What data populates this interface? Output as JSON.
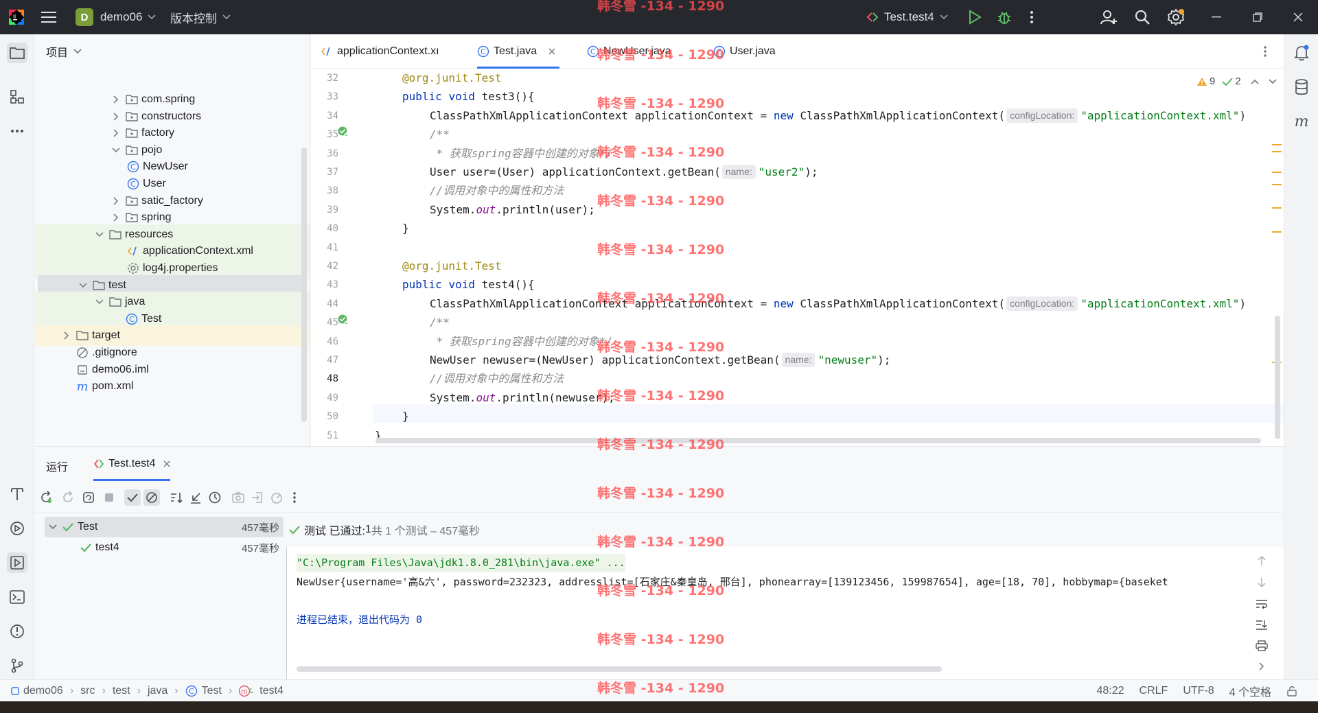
{
  "titlebar": {
    "project_badge": "D",
    "project_name": "demo06",
    "vcs_menu": "版本控制",
    "run_config": "Test.test4"
  },
  "project_panel": {
    "title": "项目",
    "tree": [
      {
        "label": "com.spring",
        "type": "package"
      },
      {
        "label": "constructors",
        "type": "package"
      },
      {
        "label": "factory",
        "type": "package"
      },
      {
        "label": "pojo",
        "type": "package"
      },
      {
        "label": "NewUser",
        "type": "class"
      },
      {
        "label": "User",
        "type": "class"
      },
      {
        "label": "satic_factory",
        "type": "package"
      },
      {
        "label": "spring",
        "type": "package"
      },
      {
        "label": "resources",
        "type": "folder"
      },
      {
        "label": "applicationContext.xml",
        "type": "xml"
      },
      {
        "label": "log4j.properties",
        "type": "properties"
      },
      {
        "label": "test",
        "type": "folder"
      },
      {
        "label": "java",
        "type": "folder"
      },
      {
        "label": "Test",
        "type": "class"
      },
      {
        "label": "target",
        "type": "folder"
      },
      {
        "label": ".gitignore",
        "type": "ignore"
      },
      {
        "label": "demo06.iml",
        "type": "iml"
      },
      {
        "label": "pom.xml",
        "type": "maven"
      }
    ]
  },
  "editor": {
    "tabs": [
      {
        "label": "applicationContext.xı",
        "icon": "xml-icon"
      },
      {
        "label": "Test.java",
        "icon": "class-icon",
        "active": true
      },
      {
        "label": "NewUser.java",
        "icon": "class-icon"
      },
      {
        "label": "User.java",
        "icon": "class-icon"
      }
    ],
    "inspections": {
      "warnings": "9",
      "ok": "2"
    },
    "line_numbers": [
      "32",
      "33",
      "34",
      "35",
      "36",
      "37",
      "38",
      "39",
      "40",
      "41",
      "42",
      "43",
      "44",
      "45",
      "46",
      "47",
      "48",
      "49",
      "50",
      "51"
    ],
    "code": {
      "l32_annotation": "@org.junit.",
      "l32_test": "Test",
      "l33_public": "public ",
      "l33_void": "void ",
      "l33_sig": "test3(){",
      "l34_a": "ClassPathXmlApplicationContext applicationContext = ",
      "l34_new": "new ",
      "l34_b": "ClassPathXmlApplicationContext(",
      "l34_hint": "configLocation:",
      "l34_str": "\"applicationContext.xml\"",
      "l34_end": ")",
      "l35": "/**",
      "l36": " * 获取spring容器中创建的对象*/",
      "l37_a": "User user=(User) applicationContext.getBean(",
      "l37_hint": "name:",
      "l37_str": "\"user2\"",
      "l37_end": ");",
      "l38": "//调用对象中的属性和方法",
      "l39_a": "System.",
      "l39_out": "out",
      "l39_b": ".println(user);",
      "l40": "}",
      "l42_annotation": "@org.junit.",
      "l42_test": "Test",
      "l43_sig": "test4(){",
      "l47_a": "NewUser newuser=(NewUser) applicationContext.getBean(",
      "l47_str": "\"newuser\"",
      "l49_b": ".println(newuser);",
      "l51": "}"
    }
  },
  "run_panel": {
    "title": "运行",
    "tab_label": "Test.test4",
    "status_check": "测试 已通过: ",
    "status_count": "1",
    "status_rest": "共 1 个测试 – 457毫秒",
    "tree": [
      {
        "label": "Test",
        "time": "457毫秒"
      },
      {
        "label": "test4",
        "time": "457毫秒"
      }
    ],
    "console": [
      "\"C:\\Program Files\\Java\\jdk1.8.0_281\\bin\\java.exe\" ...",
      "NewUser{username='高&六', password=232323, addresslist=[石家庄&秦皇岛, 邢台], phonearray=[139123456, 159987654], age=[18, 70], hobbymap={baseket",
      "",
      "进程已结束，退出代码为 0"
    ]
  },
  "statusbar": {
    "breadcrumbs": [
      "demo06",
      "src",
      "test",
      "java",
      "Test",
      "test4"
    ],
    "position": "48:22",
    "line_sep": "CRLF",
    "encoding": "UTF-8",
    "indent": "4 个空格"
  },
  "watermark": "韩冬雪 -134 - 1290"
}
